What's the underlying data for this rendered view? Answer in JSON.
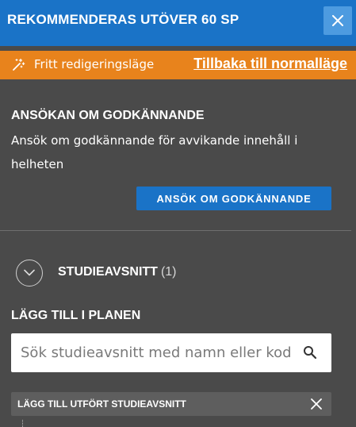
{
  "header": {
    "title": "REKOMMENDERAS UTÖVER 60 SP",
    "close_icon": "close-icon",
    "colors": {
      "header_bg": "#1a73c7",
      "close_bg": "#4d9be0"
    }
  },
  "mode_bar": {
    "icon": "magic-wand-icon",
    "label": "Fritt redigeringsläge",
    "link": "Tillbaka till normalläge",
    "color": "#e8831c"
  },
  "approval": {
    "title": "ANSÖKAN OM GODKÄNNANDE",
    "description": "Ansök om godkännande för avvikande innehåll i helheten",
    "button_label": "ANSÖK OM GODKÄNNANDE"
  },
  "study_sections": {
    "label": "STUDIEAVSNITT",
    "count": "(1)",
    "toggle_icon": "chevron-down-icon"
  },
  "add_to_plan": {
    "label": "LÄGG TILL I PLANEN",
    "search_placeholder": "Sök studieavsnitt med namn eller kod",
    "search_icon": "search-icon"
  },
  "completed": {
    "label": "LÄGG TILL UTFÖRT STUDIEAVSNITT",
    "close_icon": "close-icon"
  },
  "colors": {
    "panel_bg": "#4a4a4a",
    "accent_blue": "#1a73c7",
    "accent_orange": "#e8831c"
  }
}
